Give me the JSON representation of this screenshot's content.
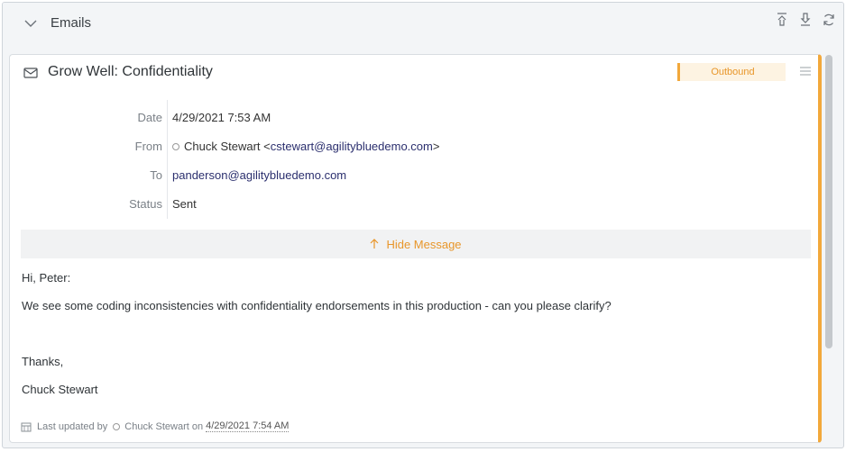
{
  "panel": {
    "title": "Emails"
  },
  "email": {
    "subject": "Grow Well: Confidentiality",
    "direction_badge": "Outbound",
    "fields": {
      "date_label": "Date",
      "date_value": "4/29/2021 7:53 AM",
      "from_label": "From",
      "from_name": "Chuck Stewart <",
      "from_email": "cstewart@agilitybluedemo.com",
      "from_close": ">",
      "to_label": "To",
      "to_value": "panderson@agilitybluedemo.com",
      "status_label": "Status",
      "status_value": "Sent"
    },
    "hide_message_label": "Hide Message",
    "body": {
      "greeting": "Hi, Peter:",
      "line1": "We see some coding inconsistencies with confidentiality endorsements in this production - can you please clarify?",
      "closing": "Thanks,",
      "signature": "Chuck Stewart"
    },
    "footer": {
      "prefix": "Last updated by",
      "user": "Chuck Stewart",
      "on": "on",
      "timestamp": "4/29/2021 7:54 AM"
    }
  },
  "colors": {
    "accent": "#f2a83b",
    "link": "#2b2f6e"
  }
}
